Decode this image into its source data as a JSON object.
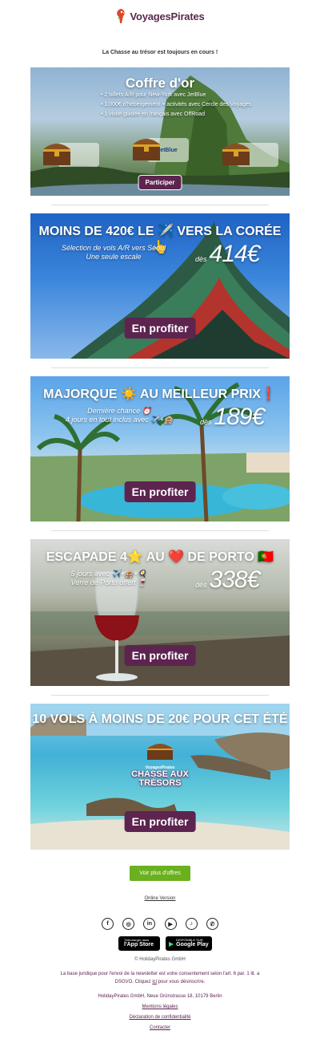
{
  "header": {
    "logo_text": "VoyagesPirates"
  },
  "tagline": "La Chasse au trésor est toujours en cours !",
  "treasure": {
    "title": "Coffre d'or",
    "bullets": [
      "2 billets A/R pour New-York avec JetBlue",
      "1.000€ d'hébergement + activités avec Cercle des Voyages",
      "1 visite guidée en français avec OffRoad"
    ],
    "partners": [
      "jetBlue"
    ],
    "cta": "Participer"
  },
  "korea": {
    "title": "MOINS DE 420€ LE ✈️ VERS LA CORÉE 👆",
    "sub1": "Sélection de vols A/R vers Séoul",
    "sub2": "Une seule escale",
    "from": "dès",
    "price": "414€",
    "cta": "En profiter"
  },
  "majorca": {
    "title": "MAJORQUE ☀️ AU MEILLEUR PRIX❗",
    "sub1": "Dernière chance ⏰",
    "sub2": "4 jours en tout inclus avec ✈️+🏨",
    "from": "dès",
    "price": "189€",
    "cta": "En profiter"
  },
  "porto": {
    "title": "ESCAPADE 4⭐ AU ❤️ DE PORTO 🇵🇹",
    "sub1": "5 jours avec ✈️+🏨+🍳",
    "sub2": "Verre de Porto offert 🍷",
    "from": "dès",
    "price": "338€",
    "cta": "En profiter"
  },
  "flights": {
    "title": "10 VOLS À MOINS DE 20€ POUR CET ÉTÉ",
    "badge_brand": "VoyagesPirates",
    "badge_line1": "CHASSE AUX",
    "badge_line2": "TRÉSORS",
    "cta": "En profiter"
  },
  "more_offers": "Voir plus d'offres",
  "online_version": "Online Version",
  "social": [
    {
      "name": "facebook-icon",
      "glyph": "f"
    },
    {
      "name": "instagram-icon",
      "glyph": "◎"
    },
    {
      "name": "linkedin-icon",
      "glyph": "in"
    },
    {
      "name": "youtube-icon",
      "glyph": "▶"
    },
    {
      "name": "tiktok-icon",
      "glyph": "♪"
    },
    {
      "name": "whatsapp-icon",
      "glyph": "✆"
    }
  ],
  "stores": {
    "apple_small": "Télécharger dans",
    "apple_big": "l'App Store",
    "google_small": "DISPONIBLE SUR",
    "google_big": "Google Play"
  },
  "footer": {
    "copyright": "© HolidayPirates GmbH",
    "legal1": "La base juridique pour l'envoi de la newsletter est votre consentement selon l'art. 6 par. 1 lit. a",
    "legal2a": "DSGVO. Cliquez ",
    "legal2link": "ici",
    "legal2b": " pour vous désinscrire.",
    "address": "HolidayPirates GmbH, Neue Grünstrasse 18, 10179 Berlin",
    "links": [
      "Mentions légales",
      "Déclaration de confidentialité",
      "Contacter"
    ]
  }
}
